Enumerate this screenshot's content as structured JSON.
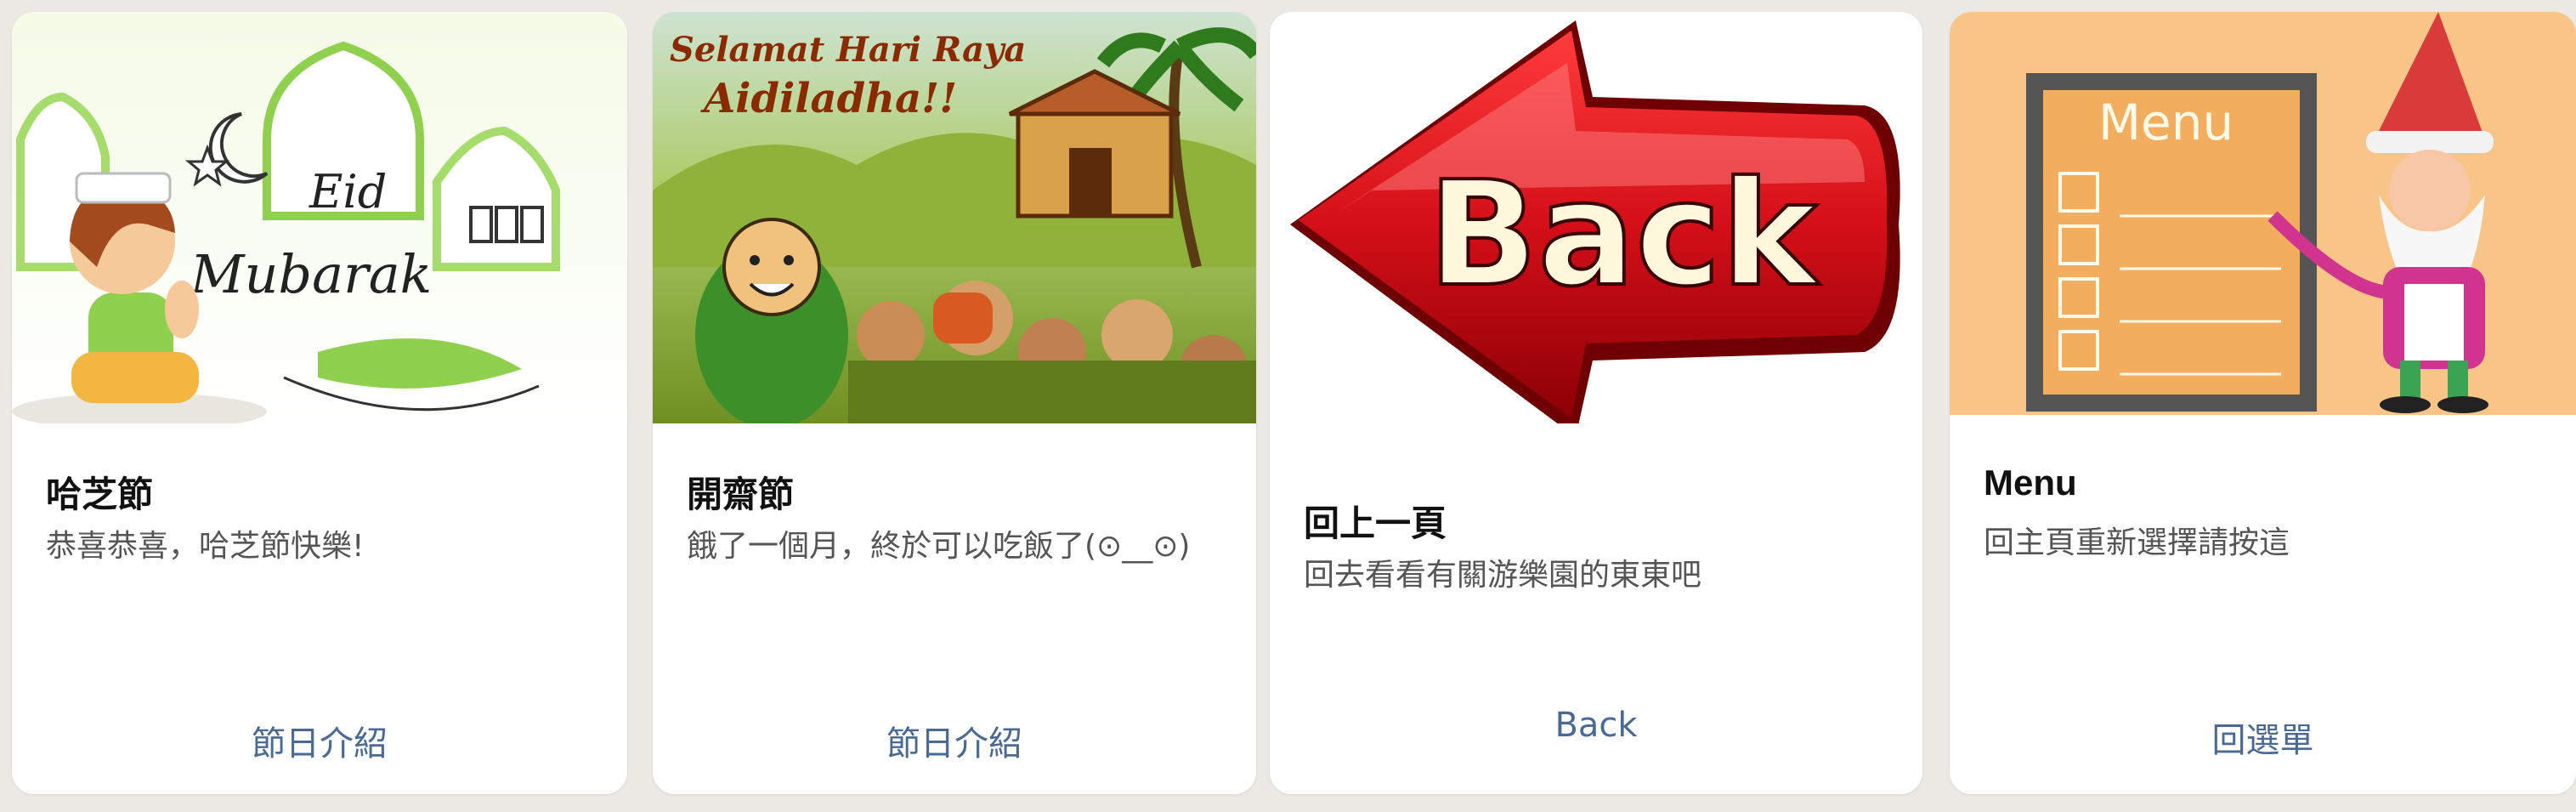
{
  "cards": [
    {
      "image": "eid-mubarak-illustration",
      "image_text": "Eid Mubarak",
      "title": "哈芝節",
      "description": "恭喜恭喜，哈芝節快樂!",
      "action_label": "節日介紹"
    },
    {
      "image": "hari-raya-village-illustration",
      "image_text": "Selamat Hari Raya Aidiladha!!",
      "title": "開齋節",
      "description": "餓了一個月，終於可以吃飯了(⊙__⊙)",
      "action_label": "節日介紹"
    },
    {
      "image": "back-arrow-illustration",
      "image_text": "Back",
      "title": "回上一頁",
      "description": "回去看看有關游樂園的東東吧",
      "action_label": "Back"
    },
    {
      "image": "menu-board-gnome-illustration",
      "image_text": "Menu",
      "title": "Menu",
      "description": "回主頁重新選擇請按這",
      "action_label": "回選單"
    }
  ],
  "colors": {
    "background": "#ece9e4",
    "card": "#ffffff",
    "title": "#111111",
    "description": "#555555",
    "action": "#4a6a96",
    "back_arrow": "#c8141c",
    "menu_bg": "#f8c487"
  }
}
